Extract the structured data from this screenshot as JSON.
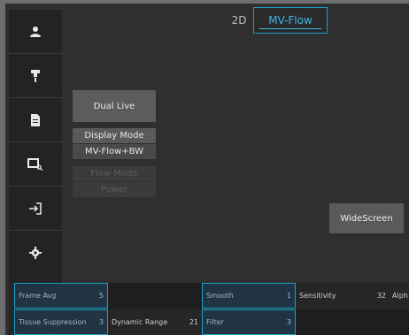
{
  "tabs": {
    "tab_2d": "2D",
    "tab_mvflow": "MV-Flow"
  },
  "sidebar": {
    "items": [
      {
        "icon": "user-icon"
      },
      {
        "icon": "probe-icon"
      },
      {
        "icon": "document-icon"
      },
      {
        "icon": "image-search-icon"
      },
      {
        "icon": "exit-icon"
      },
      {
        "icon": "gear-icon"
      }
    ]
  },
  "buttons": {
    "dual_live": "Dual Live",
    "display_mode": "Display Mode",
    "display_mode_value": "MV-Flow+BW",
    "flow_mode": "Flow Mode",
    "power": "Power",
    "widescreen": "WideScreen"
  },
  "params": {
    "row1": [
      {
        "label": "Frame Avg",
        "value": "5",
        "active": true
      },
      {
        "label": "",
        "value": "",
        "active": false
      },
      {
        "label": "Smooth",
        "value": "1",
        "active": true
      },
      {
        "label": "Sensitivity",
        "value": "32",
        "active": false
      },
      {
        "label": "Alph",
        "value": "",
        "active": false
      }
    ],
    "row2": [
      {
        "label": "Tissue Suppression",
        "value": "3",
        "active": true
      },
      {
        "label": "Dynamic Range",
        "value": "21",
        "active": false
      },
      {
        "label": "Filter",
        "value": "3",
        "active": true
      },
      {
        "label": "",
        "value": "",
        "active": false
      }
    ]
  },
  "colors": {
    "accent": "#1aa0c8",
    "accent_text": "#3fb8e6",
    "panel": "#2f2f2f"
  }
}
